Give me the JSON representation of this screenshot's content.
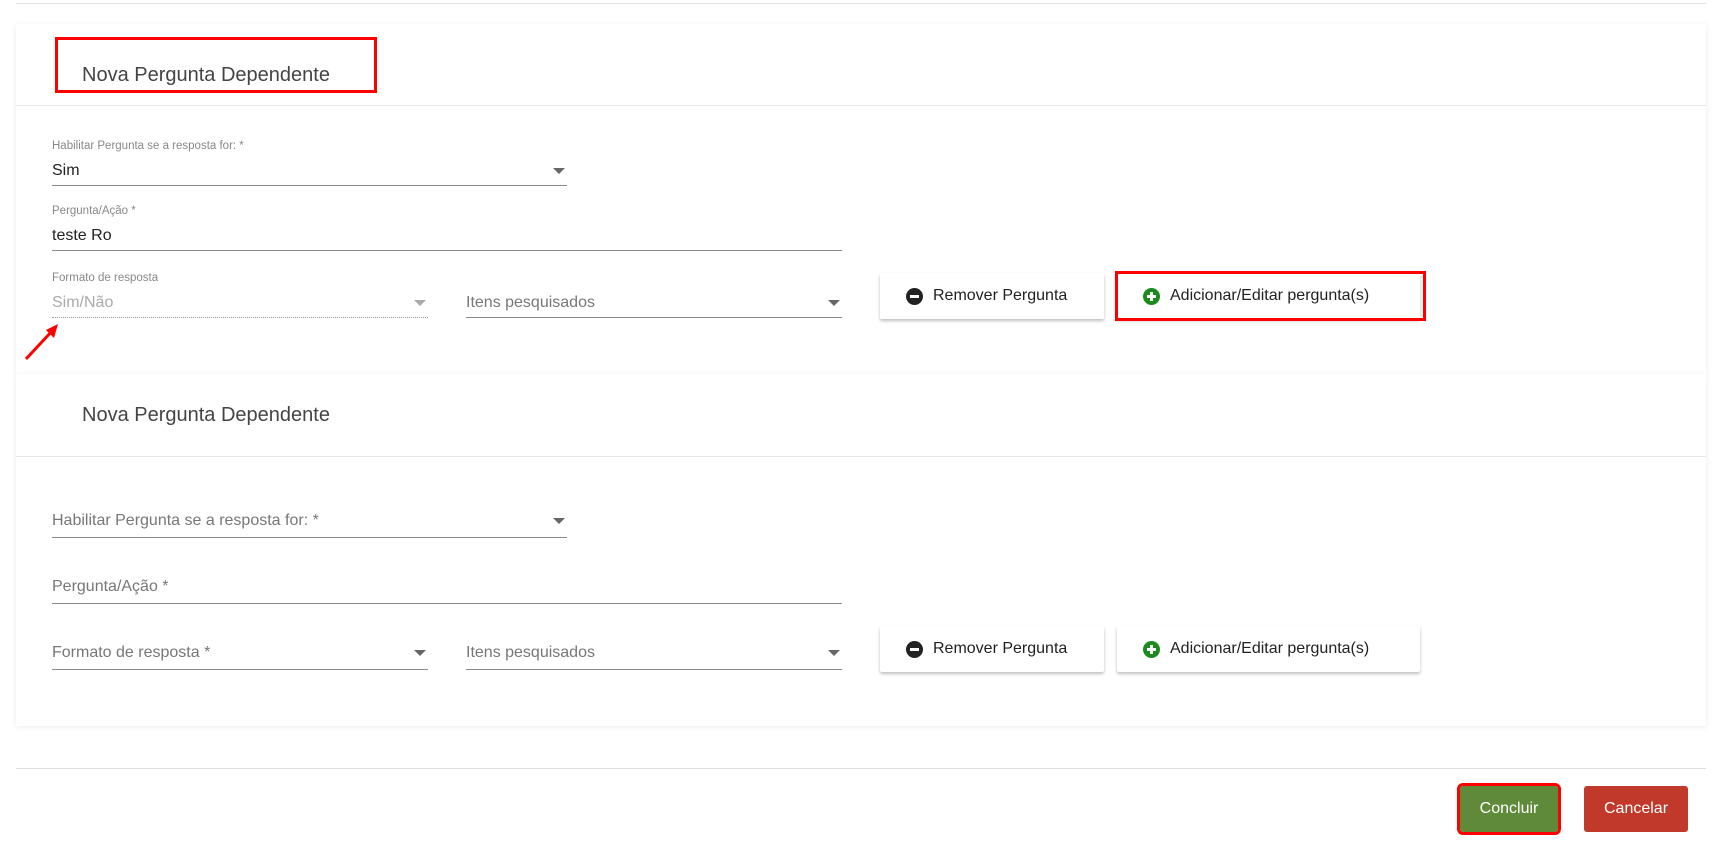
{
  "sections": [
    {
      "title": "Nova Pergunta Dependente",
      "enable_label": "Habilitar Pergunta se a resposta for: *",
      "enable_value": "Sim",
      "question_label": "Pergunta/Ação *",
      "question_value": "teste Ro",
      "format_label": "Formato de resposta",
      "format_value": "Sim/Não",
      "items_placeholder": "Itens pesquisados",
      "remove_label": "Remover Pergunta",
      "add_label": "Adicionar/Editar pergunta(s)"
    },
    {
      "title": "Nova Pergunta Dependente",
      "enable_placeholder": "Habilitar Pergunta se a resposta for: *",
      "question_placeholder": "Pergunta/Ação *",
      "format_placeholder": "Formato de resposta *",
      "items_placeholder": "Itens pesquisados",
      "remove_label": "Remover Pergunta",
      "add_label": "Adicionar/Editar pergunta(s)"
    }
  ],
  "footer": {
    "conclude_label": "Concluir",
    "cancel_label": "Cancelar",
    "conclude_color": "#5f8a3a",
    "cancel_color": "#c0392b"
  }
}
